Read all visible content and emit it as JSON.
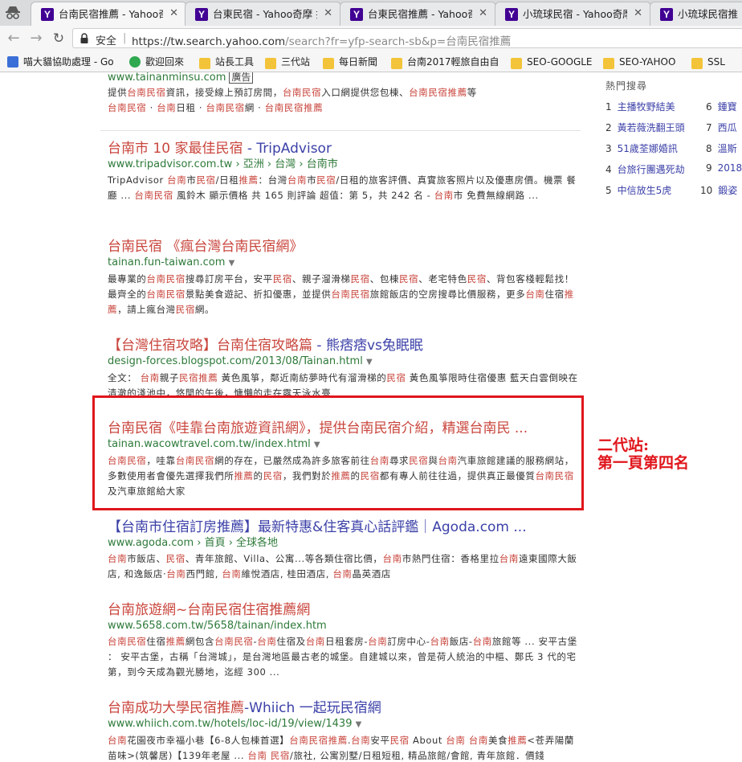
{
  "tabs": [
    {
      "title": "台南民宿推薦 - Yahoo奇",
      "active": true
    },
    {
      "title": "台東民宿 - Yahoo奇摩 搜"
    },
    {
      "title": "台東民宿推薦 - Yahoo奇"
    },
    {
      "title": "小琉球民宿 - Yahoo奇摩"
    },
    {
      "title": "小琉球民宿推"
    }
  ],
  "address_bar": {
    "secure_label": "安全",
    "url_host": "https://tw.search.yahoo.com",
    "url_rest": "/search?fr=yfp-search-sb&p=台南民宿推薦"
  },
  "bookmarks": [
    {
      "label": "喵大貓協助處理 - Go",
      "icon": "bookmark-icon-cat",
      "color": "#3b6fd8"
    },
    {
      "label": "歡迎回來",
      "icon": "evernote-icon",
      "color": "#2fa84f"
    },
    {
      "label": "站長工具",
      "icon": "folder-icon"
    },
    {
      "label": "三代站",
      "icon": "folder-icon"
    },
    {
      "label": "每日新聞",
      "icon": "folder-icon"
    },
    {
      "label": "台南2017輕旅自由自",
      "icon": "folder-icon"
    },
    {
      "label": "SEO-GOOGLE",
      "icon": "folder-icon"
    },
    {
      "label": "SEO-YAHOO",
      "icon": "folder-icon"
    },
    {
      "label": "SSL",
      "icon": "folder-icon"
    }
  ],
  "top_partial": {
    "url": "www.tainanminsu.com",
    "ad_label": "廣告",
    "line1": "提供台南民宿資訊，接受線上預訂房間，台南民宿入口網提供您包棟、台南民宿推薦等",
    "line2": "台南民宿 · 台南日租 · 台南民宿網 · 台南民宿推薦"
  },
  "results": [
    {
      "title_a": "台南市 10 家最佳民宿",
      "title_b": " - TripAdvisor",
      "url": "www.tripadvisor.com.tw",
      "breadcrumbs": "› 亞洲 › 台灣 › 台南市",
      "snippet": "TripAdvisor 台南市民宿/日租推薦：台灣台南市民宿/日租的旅客評價、真實旅客照片以及優惠房價。機票 餐廳 ... 台南民宿 風鈴木 顯示價格 共 165 則評論 超值：第 5，共 242 名 - 台南市 免費無線網路 ..."
    },
    {
      "title_a": "台南民宿 《瘋台灣台南民宿網》",
      "title_b": "",
      "url": "tainan.fun-taiwan.com",
      "breadcrumbs": "",
      "snippet": "最專業的台南民宿搜尋訂房平台，安平民宿、親子溜滑梯民宿、包棟民宿、老宅特色民宿、背包客棧輕鬆找！最齊全的台南民宿景點美食遊記、折扣優惠，並提供台南民宿旅館飯店的空房搜尋比價服務，更多台南住宿推薦，請上瘋台灣民宿網。"
    },
    {
      "title_a": "【台灣住宿攻略】台南住宿攻略篇",
      "title_b": " - 熊痞痞vs兔眠眠",
      "url": "design-forces.blogspot.com/2013/08/Tainan.html",
      "breadcrumbs": "",
      "snippet": "全文： 台南親子民宿推薦 黃色風箏，鄰近南紡夢時代有溜滑梯的民宿 黃色風箏限時住宿優惠 藍天白雲倒映在清澈的淺池中，悠閒的午後，慵懶的走在露天泳水臺"
    },
    {
      "title_a": "台南民宿《哇靠台南旅遊資訊網》，提供台南民宿介紹，精選台南民 ...",
      "title_b": "",
      "url": "tainan.wacowtravel.com.tw/index.html",
      "breadcrumbs": "",
      "snippet": "台南民宿，哇靠台南民宿網的存在，已嚴然成為許多旅客前往台南尋求民宿與台南汽車旅館建議的服務網站，多數使用者會優先選擇我們所推薦的民宿，我們對於推薦的民宿都有專人前往往過，提供真正最優質台南民宿及汽車旅館給大家"
    },
    {
      "title_a": "【台南市住宿訂房推薦】",
      "title_b": "最新特惠&住客真心話評鑑｜Agoda.com ...",
      "url": "www.agoda.com",
      "breadcrumbs": "› 首頁 › 全球各地",
      "snippet": "台南市飯店、民宿、青年旅館、Villa、公寓...等各類住宿比價，台南市熱門住宿：香格里拉台南遠東國際大飯店, 和逸飯店·台南西門館, 台南維悅酒店, 桂田酒店, 台南晶英酒店"
    },
    {
      "title_a": "台南旅遊網~台南民宿住宿推薦網",
      "title_b": "",
      "url": "www.5658.com.tw/5658/tainan/index.htm",
      "breadcrumbs": "",
      "snippet": "台南民宿住宿推薦網包含台南民宿-台南住宿及台南日租套房-台南訂房中心-台南飯店-台南旅館等 ... 安平古堡 ： 安平古堡，古稱「台灣城」，是台灣地區最古老的城堡。自建城以來，曾是荷人統治的中樞、鄭氏 3 代的宅第，到今天成為觀光勝地，迄經 300 ..."
    },
    {
      "title_a": "台南成功大學民宿推薦",
      "title_b": "-Whiich 一起玩民宿網",
      "url": "www.whiich.com.tw/hotels/loc-id/19/view/1439",
      "breadcrumbs": "",
      "snippet": "台南花園夜市幸福小巷【6-8人包棟首選】台南民宿推薦.台南安平民宿 About 台南 台南美食推薦<苍弄陽蘭苗味>(筑馨居)【139年老屋 ... 台南 民宿/旅社, 公寓別墅/日租短租, 精品旅館/會館, 青年旅館．價錢"
    }
  ],
  "hot_searches": {
    "header": "熱門搜尋",
    "items": [
      {
        "n": "1",
        "t": "主播牧野結美"
      },
      {
        "n": "2",
        "t": "黃若薇洗翻王頭"
      },
      {
        "n": "3",
        "t": "51歲荃娜婚訊"
      },
      {
        "n": "4",
        "t": "台旅行團遇死劫"
      },
      {
        "n": "5",
        "t": "中信放生5虎"
      },
      {
        "n": "6",
        "t": "鍾寶"
      },
      {
        "n": "7",
        "t": "西瓜"
      },
      {
        "n": "8",
        "t": "溫斯"
      },
      {
        "n": "9",
        "t": "2018"
      },
      {
        "n": "10",
        "t": "鍛姿"
      }
    ]
  },
  "annotation": {
    "line1": "二代站:",
    "line2": "第一頁第四名",
    "color": "#e0161c"
  }
}
